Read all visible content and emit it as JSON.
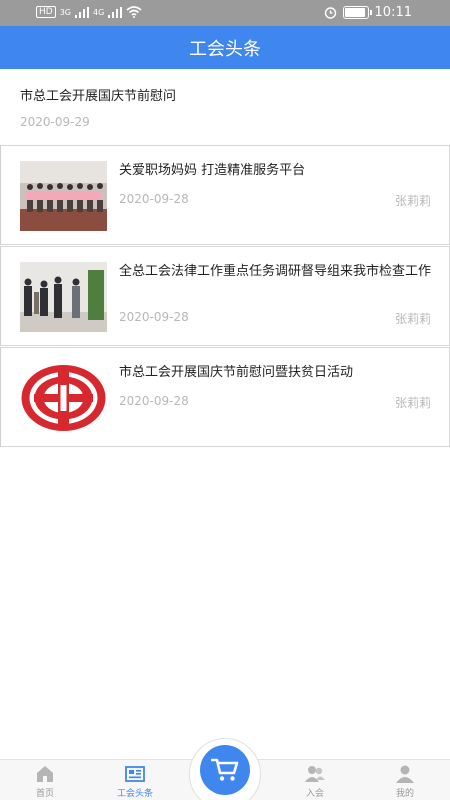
{
  "status_bar": {
    "left_text": "HD",
    "network_a": "3G",
    "network_b": "4G",
    "time": "10:11",
    "battery_percent": 95
  },
  "header": {
    "title": "工会头条"
  },
  "top_news": {
    "title": "市总工会开展国庆节前慰问",
    "date": "2020-09-29"
  },
  "news": [
    {
      "title": "关爱职场妈妈 打造精准服务平台",
      "date": "2020-09-28",
      "author": "张莉莉"
    },
    {
      "title": "全总工会法律工作重点任务调研督导组来我市检查工作",
      "date": "2020-09-28",
      "author": "张莉莉"
    },
    {
      "title": "市总工会开展国庆节前慰问暨扶贫日活动",
      "date": "2020-09-28",
      "author": "张莉莉"
    }
  ],
  "tabbar": {
    "items": [
      {
        "label": "首页",
        "icon": "home-icon"
      },
      {
        "label": "工会头条",
        "icon": "newspaper-icon"
      },
      {
        "label": "入会",
        "icon": "users-icon"
      },
      {
        "label": "我的",
        "icon": "person-icon"
      }
    ],
    "active_index": 1,
    "center_icon": "cart-icon"
  },
  "colors": {
    "accent": "#3f86ef",
    "muted_text": "#b8b8b8",
    "status_bar": "#9b9b9b"
  }
}
